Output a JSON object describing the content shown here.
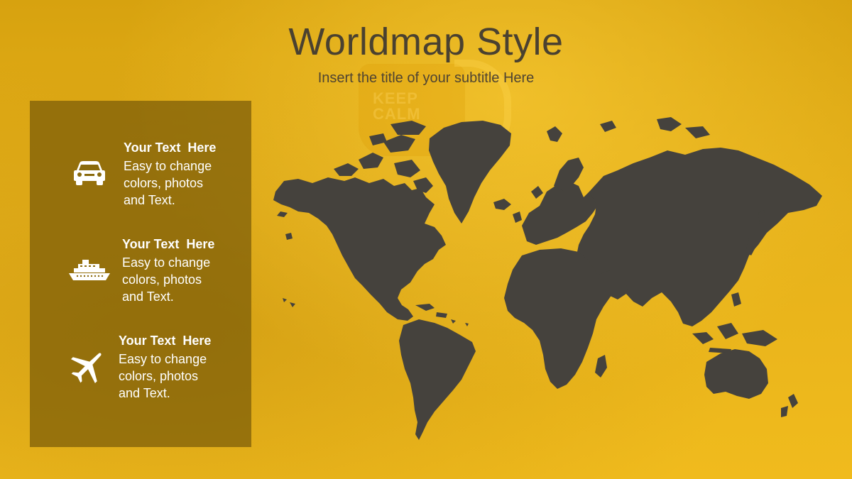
{
  "slide": {
    "title": "Worldmap Style",
    "subtitle": "Insert the title of your subtitle Here"
  },
  "background": {
    "mug_text": "KEEP\nCALM"
  },
  "panel": {
    "items": [
      {
        "icon": "car-icon",
        "title": "Your Text  Here",
        "description": "Easy to change\ncolors, photos\nand Text."
      },
      {
        "icon": "ship-icon",
        "title": "Your Text  Here",
        "description": "Easy to change\ncolors, photos\nand Text."
      },
      {
        "icon": "airplane-icon",
        "title": "Your Text  Here",
        "description": "Easy to change\ncolors, photos\nand Text."
      }
    ]
  },
  "colors": {
    "background": "#e2ad14",
    "panel": "#7a5c08",
    "map": "#45423d",
    "title": "#4a4130",
    "text": "#ffffff"
  }
}
